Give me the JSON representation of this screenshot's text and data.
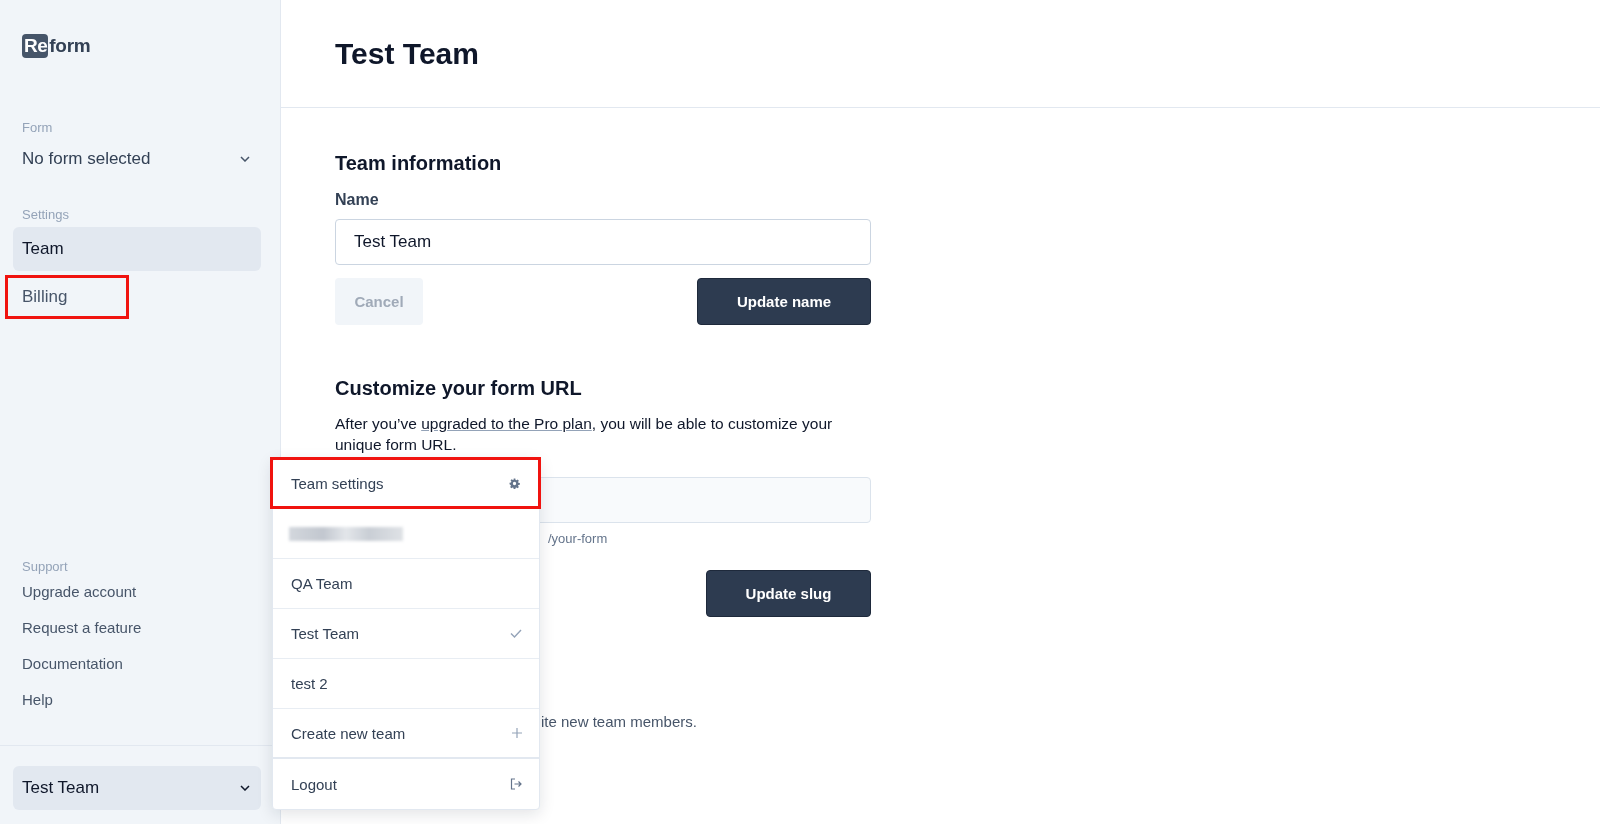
{
  "logo": {
    "boxed": "Re",
    "text": "form"
  },
  "sidebar": {
    "form_section": {
      "heading": "Form",
      "select": "No form selected"
    },
    "settings_section": {
      "heading": "Settings",
      "items": [
        {
          "label": "Team",
          "selected": true,
          "highlighted": false
        },
        {
          "label": "Billing",
          "selected": false,
          "highlighted": true
        }
      ]
    },
    "support_section": {
      "heading": "Support",
      "items": [
        "Upgrade account",
        "Request a feature",
        "Documentation",
        "Help"
      ]
    },
    "team_select": "Test Team"
  },
  "page": {
    "title": "Test Team",
    "team_information": {
      "heading": "Team information",
      "name_label": "Name",
      "name_value": "Test Team",
      "cancel_button": {
        "label": "Cancel",
        "disabled": true
      },
      "update_button": "Update name"
    },
    "customize_url": {
      "heading": "Customize your form URL",
      "text": "After you’ve ",
      "link": "upgraded to the Pro plan",
      "text_after": ", you will be able to customize your unique form URL.",
      "hint_visible": "/your-form",
      "update_button": "Update slug"
    },
    "members_text_visible": "ite new team members."
  },
  "team_menu": {
    "items": [
      {
        "kind": "settings",
        "label": "Team settings",
        "highlighted": true
      },
      {
        "kind": "redacted",
        "highlighted": false
      },
      {
        "kind": "team",
        "label": "QA Team",
        "selected": false,
        "highlighted": false
      },
      {
        "kind": "team",
        "label": "Test Team",
        "selected": true,
        "highlighted": false
      },
      {
        "kind": "team",
        "label": "test 2",
        "selected": false,
        "highlighted": false
      },
      {
        "kind": "create",
        "label": "Create new team",
        "highlighted": false
      },
      {
        "kind": "logout",
        "label": "Logout",
        "highlighted": false
      }
    ]
  }
}
